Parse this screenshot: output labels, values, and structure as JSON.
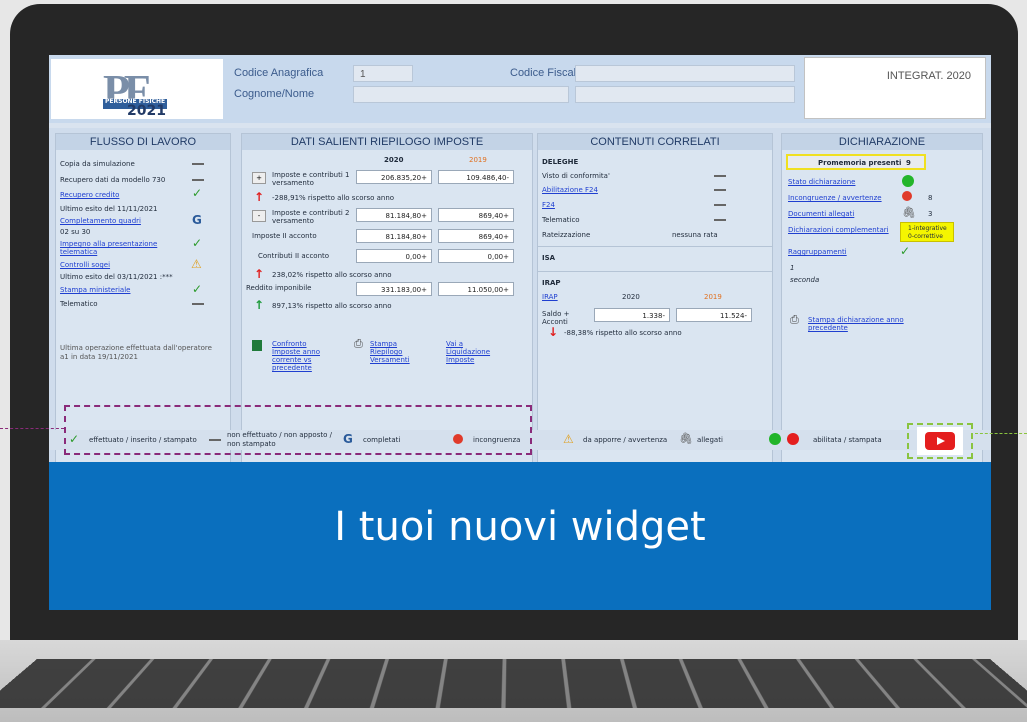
{
  "header": {
    "logo_brand": "PERSONE FISICHE",
    "logo_year": "2021",
    "codice_anagrafica_label": "Codice Anagrafica",
    "codice_anagrafica_value": "1",
    "codice_fiscale_label": "Codice Fiscale",
    "cognome_nome_label": "Cognome/Nome",
    "dichiarazione_type": "INTEGRAT. 2020"
  },
  "flusso": {
    "title": "FLUSSO DI LAVORO",
    "copia": "Copia da simulazione",
    "recupero730": "Recupero dati da modello 730",
    "recupero_credito": "Recupero credito",
    "ultimo_esito1": "Ultimo esito del 11/11/2021",
    "completamento": "Completamento quadri",
    "completamento_count": "02 su 30",
    "impegno": "Impegno alla presentazione telematica",
    "controlli": "Controlli sogei",
    "ultimo_esito2": "Ultimo esito del 03/11/2021 :***",
    "stampa_min": "Stampa ministeriale",
    "telematico": "Telematico",
    "footer": "Ultima operazione effettuata dall'operatore a1   in data 19/11/2021"
  },
  "dati": {
    "title": "DATI SALIENTI RIEPILOGO IMPOSTE",
    "year_current": "2020",
    "year_prev": "2019",
    "imposte1_label": "Imposte e contributi 1 versamento",
    "imposte1_2020": "206.835,20+",
    "imposte1_2019": "109.486,40-",
    "imposte1_pct": "-288,91% rispetto allo scorso anno",
    "imposte2_label": "Imposte e contributi 2 versamento",
    "imposte2_2020": "81.184,80+",
    "imposte2_2019": "869,40+",
    "imposteII_label": "Imposte II acconto",
    "imposteII_2020": "81.184,80+",
    "imposteII_2019": "869,40+",
    "contributiII_label": "Contributi II acconto",
    "contributiII_2020": "0,00+",
    "contributiII_2019": "0,00+",
    "pct2": "238,02% rispetto allo scorso anno",
    "reddito_label": "Reddito imponibile",
    "reddito_2020": "331.183,00+",
    "reddito_2019": "11.050,00+",
    "pct3": "897,13% rispetto allo scorso anno",
    "link1": "Confronto Imposte anno corrente vs precedente",
    "link2": "Stampa Riepilogo Versamenti",
    "link3": "Vai a Liquidazione Imposte",
    "plus_sign": "+",
    "minus_sign": "-"
  },
  "contenuti": {
    "title": "CONTENUTI CORRELATI",
    "deleghe": "DELEGHE",
    "visto": "Visto di conformita'",
    "abilitazione": "Abilitazione F24",
    "f24": "F24",
    "telematico": "Telematico",
    "rateizzazione": "Rateizzazione",
    "rateizzazione_val": "nessuna rata",
    "isa": "ISA",
    "irap": "IRAP",
    "irap_link": "IRAP",
    "irap_2020": "2020",
    "irap_2019": "2019",
    "saldo": "Saldo + Acconti",
    "saldo_2020": "1.338-",
    "saldo_2019": "11.524-",
    "irap_pct": "-88,38% rispetto allo scorso anno"
  },
  "dichiarazione": {
    "title": "DICHIARAZIONE",
    "promemoria": "Promemoria presenti",
    "promemoria_count": "9",
    "stato": "Stato dichiarazione",
    "incongruenze": "Incongruenze / avvertenze",
    "incongruenze_count": "8",
    "documenti": "Documenti allegati",
    "documenti_count": "3",
    "complementari": "Dichiarazioni complementari",
    "complementari_note1": "1-integrative",
    "complementari_note2": "0-correttive",
    "raggruppamenti": "Raggruppamenti",
    "ragg_num": "1",
    "ragg_val": "seconda",
    "stampa_link": "Stampa dichiarazione anno precedente"
  },
  "legend": {
    "effettuato": "effettuato / inserito / stampato",
    "non_effettuato_1": "non effettuato / non apposto /",
    "non_effettuato_2": "non stampato",
    "completati": "completati",
    "incongruenza": "incongruenza",
    "da_apporre": "da apporre / avvertenza",
    "allegati": "allegati",
    "abilitata": "abilitata / stampata"
  },
  "caption": "I tuoi nuovi widget",
  "colors": {
    "caption_bg": "#0a6fbe",
    "highlight_purple": "#8a2b7a",
    "highlight_green": "#8ac43f",
    "ok_green": "#2c9a2c",
    "error_red": "#e02020"
  }
}
